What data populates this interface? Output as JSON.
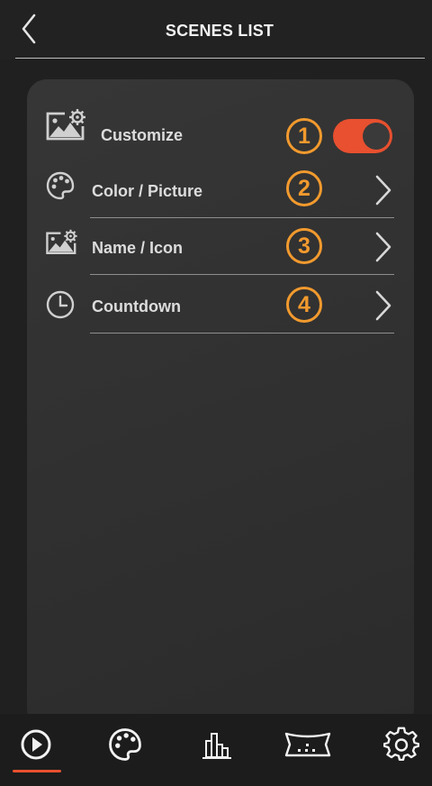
{
  "header": {
    "title": "SCENES LIST",
    "back_icon": "chevron-left-icon"
  },
  "customize": {
    "label": "Customize",
    "icon": "image-gear-icon",
    "badge": "1",
    "enabled": true,
    "accent": "#e8502f"
  },
  "items": [
    {
      "label": "Color / Picture",
      "icon": "palette-icon",
      "badge": "2"
    },
    {
      "label": "Name / Icon",
      "icon": "image-gear-icon",
      "badge": "3"
    },
    {
      "label": "Countdown",
      "icon": "clock-icon",
      "badge": "4"
    }
  ],
  "badge_color": "#f29a2e",
  "bottom_nav": {
    "items": [
      "play-icon",
      "palette-icon",
      "bar-chart-icon",
      "stage-icon",
      "settings-icon"
    ],
    "active": "play-icon"
  }
}
